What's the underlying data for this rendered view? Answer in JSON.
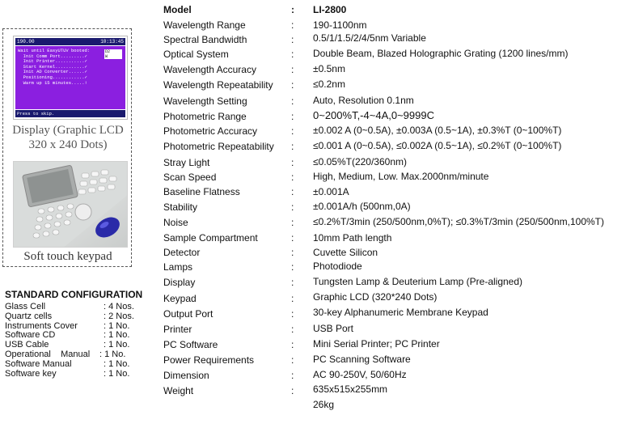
{
  "lcd": {
    "title_left": "190.00",
    "title_right": "10:13:45",
    "lines": [
      "Wait until EasyUTUV booted:",
      "  Init Comm Port.........✓",
      "  Init Printer...........✓",
      "  Start Kernel...........✓",
      "  Init AD Converter......✓",
      "  Positioning............✓",
      "  Warm up 15 minutes.....!"
    ],
    "badge_lines": [
      "D2",
      "W"
    ],
    "footer": "Press     to skip."
  },
  "captions": {
    "display": "Display (Graphic LCD 320 x 240 Dots)",
    "keypad": "Soft touch keypad"
  },
  "standard_configuration": {
    "title": "STANDARD CONFIGURATION",
    "items": [
      {
        "name": "Glass Cell",
        "qty": ": 4 Nos."
      },
      {
        "name": "Quartz cells",
        "qty": ": 2 Nos."
      },
      {
        "name": "Instruments Cover",
        "qty": ": 1 No."
      },
      {
        "name": "Software CD",
        "qty": ": 1 No."
      },
      {
        "name": "USB Cable",
        "qty": ": 1 No."
      },
      {
        "name": "Operational    Manual",
        "qty": ":  1   No."
      },
      {
        "name": "Software Manual",
        "qty": ": 1 No."
      },
      {
        "name": "Software key",
        "qty": ": 1 No."
      }
    ]
  },
  "specs": {
    "header": {
      "label": "Model",
      "colon": ":",
      "value": "LI-2800"
    },
    "labels": [
      "Wavelength Range",
      "Spectral Bandwidth",
      "Optical System",
      "Wavelength      Accuracy",
      "Wavelength    Repeatability",
      "Wavelength Setting",
      "Photometric Range",
      "Photometric        Accuracy",
      "Photometric    Repeatability",
      "Stray Light",
      "Scan Speed",
      "Baseline Flatness",
      "Stability",
      "Noise",
      "Sample Compartment",
      "Detector",
      "Lamps",
      "Display",
      "Keypad",
      "Output Port",
      "Printer",
      "PC Software",
      "Power Requirements",
      "Dimension",
      "Weight"
    ],
    "values": [
      "190-1100nm",
      "0.5/1/1.5/2/4/5nm Variable",
      "Double Beam, Blazed Holographic Grating (1200 lines/mm)",
      "±0.5nm",
      "≤0.2nm",
      "Auto, Resolution 0.1nm",
      "0~200%T,-4~4A,0~9999C",
      "±0.002 A (0~0.5A), ±0.003A (0.5~1A), ±0.3%T (0~100%T)",
      "≤0.001 A (0~0.5A), ≤0.002A (0.5~1A), ≤0.2%T (0~100%T)",
      "≤0.05%T(220/360nm)",
      "High, Medium, Low. Max.2000nm/minute",
      "±0.001A",
      "±0.001A/h (500nm,0A)",
      "≤0.2%T/3min (250/500nm,0%T); ≤0.3%T/3min (250/500nm,100%T)",
      "10mm Path length",
      "Cuvette Silicon",
      "Photodiode",
      "Tungsten Lamp & Deuterium Lamp (Pre-aligned)",
      "Graphic LCD (320*240 Dots)",
      "30-key Alphanumeric Membrane Keypad",
      "USB Port",
      "Mini Serial Printer; PC Printer",
      "PC Scanning Software",
      "AC 90-250V,    50/60Hz",
      "635x515x255mm",
      "26kg"
    ]
  }
}
